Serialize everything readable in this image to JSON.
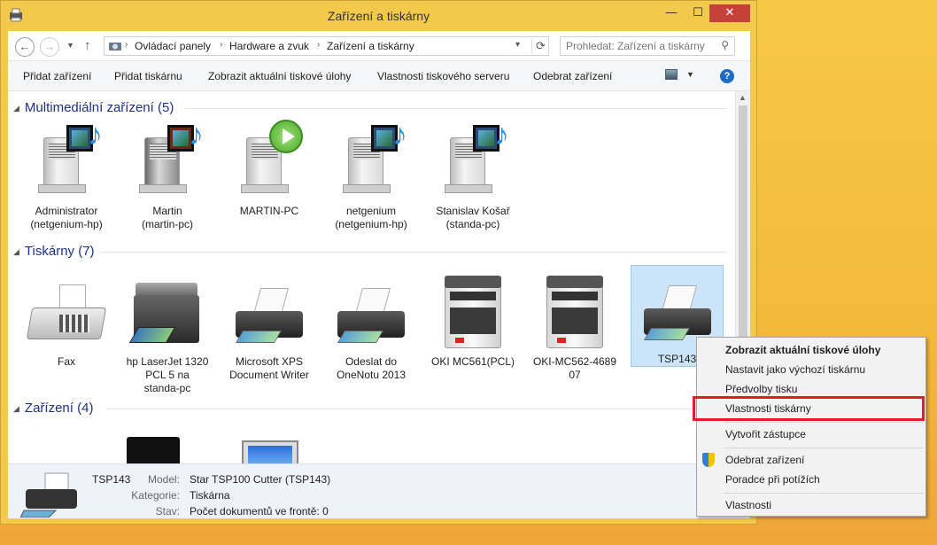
{
  "window": {
    "title": "Zařízení a tiskárny",
    "min_label": "—",
    "max_label": "☐",
    "close_label": "✕"
  },
  "nav": {
    "back_label": "←",
    "forward_label": "→",
    "recent_label": "▼",
    "up_label": "↑",
    "breadcrumbs": [
      "Ovládací panely",
      "Hardware a zvuk",
      "Zařízení a tiskárny"
    ],
    "separator": "›",
    "dropdown_label": "▾",
    "refresh_label": "⟳",
    "search_placeholder": "Prohledat: Zařízení a tiskárny",
    "search_icon": "⚲"
  },
  "toolbar": {
    "items": [
      "Přidat zařízení",
      "Přidat tiskárnu",
      "Zobrazit aktuální tiskové úlohy",
      "Vlastnosti tiskového serveru",
      "Odebrat zařízení"
    ],
    "view_drop": "▼",
    "help_label": "?"
  },
  "groups": {
    "tri": "◢",
    "multimedia": {
      "title": "Multimediální zařízení (5)",
      "devices": [
        {
          "line1": "Administrator",
          "line2": "(netgenium-hp)"
        },
        {
          "line1": "Martin",
          "line2": "(martin-pc)"
        },
        {
          "line1": "MARTIN-PC",
          "line2": ""
        },
        {
          "line1": "netgenium",
          "line2": "(netgenium-hp)"
        },
        {
          "line1": "Stanislav Košař",
          "line2": "(standa-pc)"
        }
      ]
    },
    "printers": {
      "title": "Tiskárny (7)",
      "devices": [
        {
          "line1": "Fax",
          "line2": "",
          "line3": ""
        },
        {
          "line1": "hp LaserJet 1320",
          "line2": "PCL 5 na",
          "line3": "standa-pc"
        },
        {
          "line1": "Microsoft XPS",
          "line2": "Document Writer",
          "line3": ""
        },
        {
          "line1": "Odeslat do",
          "line2": "OneNotu 2013",
          "line3": ""
        },
        {
          "line1": "OKI MC561(PCL)",
          "line2": "",
          "line3": ""
        },
        {
          "line1": "OKI-MC562-4689",
          "line2": "07",
          "line3": ""
        },
        {
          "line1": "TSP143",
          "line2": "",
          "line3": ""
        }
      ]
    },
    "devices": {
      "title": "Zařízení (4)"
    }
  },
  "details": {
    "name": "TSP143",
    "model_key": "Model:",
    "model_val": "Star TSP100 Cutter (TSP143)",
    "category_key": "Kategorie:",
    "category_val": "Tiskárna",
    "status_key": "Stav:",
    "status_val": "Počet dokumentů ve frontě: 0"
  },
  "context_menu": {
    "items": [
      "Zobrazit aktuální tiskové úlohy",
      "Nastavit jako výchozí tiskárnu",
      "Předvolby tisku",
      "Vlastnosti tiskárny",
      "Vytvořit zástupce",
      "Odebrat zařízení",
      "Poradce při potížích",
      "Vlastnosti"
    ]
  },
  "colors": {
    "accent_window": "#f2c94b",
    "selection": "#cce4f7",
    "highlight_frame": "#e21d2b",
    "link_blue": "#1e3287"
  },
  "scroll": {
    "up": "▲",
    "down": "▼"
  }
}
